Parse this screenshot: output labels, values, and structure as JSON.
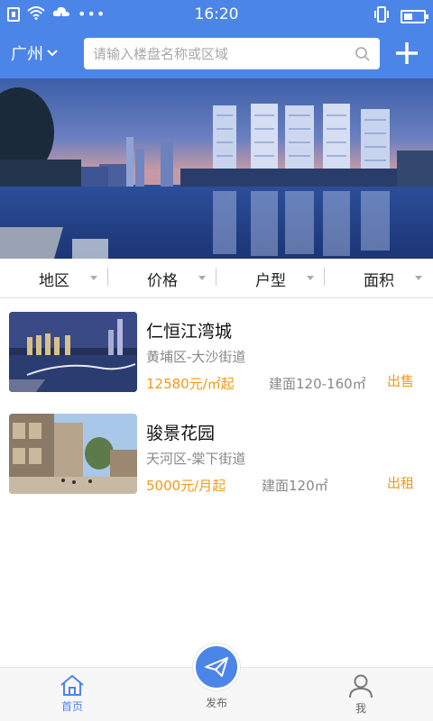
{
  "status_bar": {
    "time": "16:20",
    "icons": [
      "notification-icon",
      "wifi-icon",
      "cloud-icon",
      "more-dots-icon",
      "vibrate-icon",
      "battery-icon"
    ]
  },
  "header": {
    "city": "广州",
    "search_placeholder": "请输入楼盘名称或区域",
    "plus_icon": "plus-icon",
    "background": "#4c85e8"
  },
  "banner": {
    "image": "city-night-waterfront-towers"
  },
  "filters": [
    {
      "label": "地区"
    },
    {
      "label": "价格"
    },
    {
      "label": "户型"
    },
    {
      "label": "面积"
    }
  ],
  "listings": [
    {
      "name": "仁恒江湾城",
      "area": "黄埔区-大沙街道",
      "price": "12580元/㎡起",
      "size": "建面120-160㎡",
      "tag": "出售"
    },
    {
      "name": "骏景花园",
      "area": "天河区-棠下街道",
      "price": "5000元/月起",
      "size": "建面120㎡",
      "tag": "出租"
    }
  ],
  "bottom_nav": {
    "home": "首页",
    "publish": "发布",
    "me": "我"
  },
  "colors": {
    "accent": "#4c85e8",
    "price": "#f09a17"
  }
}
